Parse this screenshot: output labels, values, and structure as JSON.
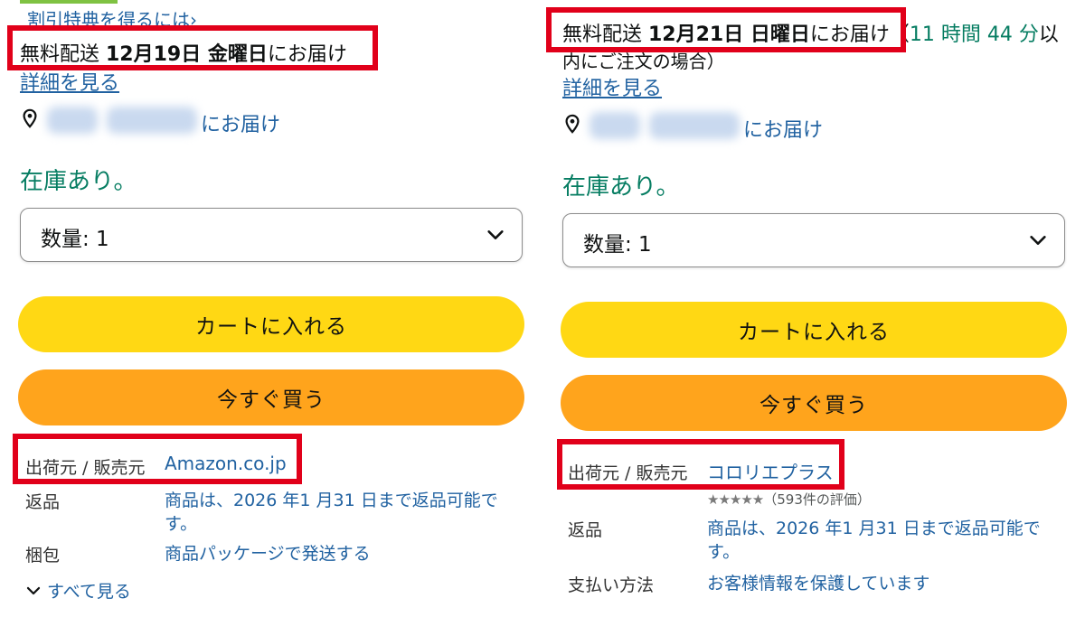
{
  "left": {
    "top_link": "割引特典を得るには",
    "top_link_chevron": "›",
    "delivery": {
      "prefix": "無料配送 ",
      "date": "12月19日 金曜日",
      "suffix": "にお届け"
    },
    "details_link": "詳細を見る",
    "deliver_to": "にお届け",
    "stock": "在庫あり。",
    "quantity": "数量: 1",
    "cart_button": "カートに入れる",
    "buy_now_button": "今すぐ買う",
    "ships_from_label": "出荷元 / 販売元",
    "ships_from_value": "Amazon.co.jp",
    "returns_label": "返品",
    "returns_value_line1": "商品は、2026 年1 月31 日まで返品可能で",
    "returns_value_line2": "す。",
    "packaging_label": "梱包",
    "packaging_value": "商品パッケージで発送する",
    "see_all": "すべて見る"
  },
  "right": {
    "delivery": {
      "prefix": "無料配送 ",
      "date": "12月21日 日曜日",
      "suffix": "にお届け"
    },
    "countdown": {
      "open": "（",
      "time": "11 時間 44 分",
      "trail": "以"
    },
    "order_note": "内にご注文の場合）",
    "details_link": "詳細を見る",
    "deliver_to": "にお届け",
    "stock": "在庫あり。",
    "quantity": "数量: 1",
    "cart_button": "カートに入れる",
    "buy_now_button": "今すぐ買う",
    "ships_from_label": "出荷元 / 販売元",
    "ships_from_value": "コロリエプラス",
    "rating_stars": "★★★★★",
    "rating_count": "（593件の評価）",
    "returns_label": "返品",
    "returns_value_line1": "商品は、2026 年1 月31 日まで返品可能で",
    "returns_value_line2": "す。",
    "payment_label": "支払い方法",
    "payment_value": "お客様情報を保護しています"
  },
  "colors": {
    "highlight_box": "#e1001a",
    "cart_button": "#ffd814",
    "buy_button": "#ffa41c",
    "link": "#2162a1",
    "in_stock": "#067d62"
  },
  "icons": [
    "location-pin-icon",
    "chevron-down-icon"
  ]
}
